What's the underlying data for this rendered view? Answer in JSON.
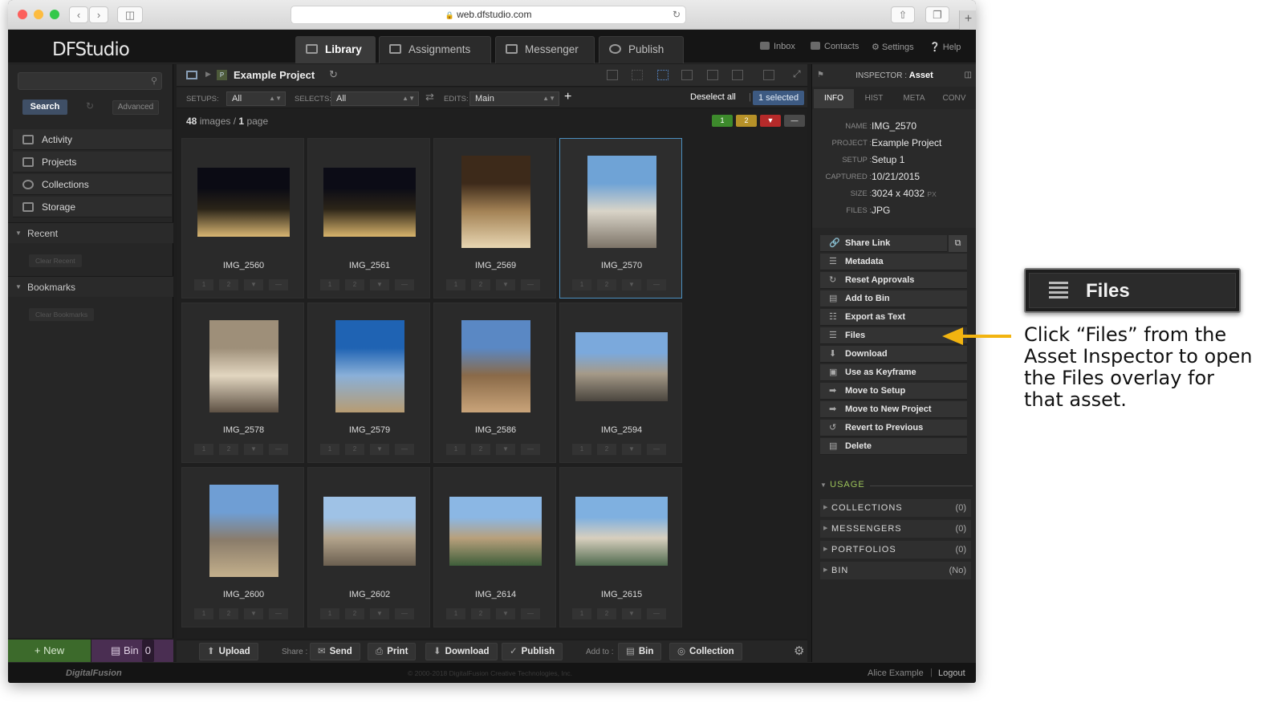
{
  "browser": {
    "url": "web.dfstudio.com"
  },
  "app": {
    "logo": "DFStudio",
    "tabs": [
      "Library",
      "Assignments",
      "Messenger",
      "Publish"
    ],
    "top_links": [
      "Inbox",
      "Contacts",
      "Settings",
      "Help"
    ]
  },
  "sidebar": {
    "search_button": "Search",
    "advanced_button": "Advanced",
    "nav": [
      "Activity",
      "Projects",
      "Collections",
      "Storage"
    ],
    "recent": "Recent",
    "clear_recent": "Clear Recent",
    "bookmarks": "Bookmarks",
    "clear_bookmarks": "Clear Bookmarks",
    "new_button": "+ New",
    "bin_label": "Bin",
    "bin_count": "0"
  },
  "library": {
    "project_badge": "P",
    "title": "Example Project",
    "setups_label": "SETUPS:",
    "setups_value": "All",
    "selects_label": "SELECTS:",
    "selects_value": "All",
    "edits_label": "EDITS:",
    "edits_value": "Main",
    "deselect": "Deselect all",
    "selected": "1 selected",
    "count_images": "48",
    "count_images_label": "images /",
    "count_pages": "1",
    "count_pages_label": "page",
    "rating_buttons": [
      "1",
      "2",
      "▼",
      "—"
    ],
    "images": [
      {
        "name": "IMG_2560"
      },
      {
        "name": "IMG_2561"
      },
      {
        "name": "IMG_2569"
      },
      {
        "name": "IMG_2570",
        "selected": true
      },
      {
        "name": "IMG_2578"
      },
      {
        "name": "IMG_2579"
      },
      {
        "name": "IMG_2586"
      },
      {
        "name": "IMG_2594"
      },
      {
        "name": "IMG_2600"
      },
      {
        "name": "IMG_2602"
      },
      {
        "name": "IMG_2614"
      },
      {
        "name": "IMG_2615"
      }
    ],
    "bottom": {
      "upload": "Upload",
      "share_label": "Share :",
      "send": "Send",
      "print": "Print",
      "download": "Download",
      "publish": "Publish",
      "addto_label": "Add to :",
      "bin": "Bin",
      "collection": "Collection"
    }
  },
  "inspector": {
    "title_prefix": "INSPECTOR :",
    "title": "Asset",
    "tabs": [
      "INFO",
      "HIST",
      "META",
      "CONV"
    ],
    "fields": [
      {
        "key": "NAME :",
        "value": "IMG_2570"
      },
      {
        "key": "PROJECT :",
        "value": "Example Project"
      },
      {
        "key": "SETUP :",
        "value": "Setup 1"
      },
      {
        "key": "CAPTURED :",
        "value": "10/21/2015"
      },
      {
        "key": "SIZE :",
        "value": "3024 x 4032",
        "unit": "PX"
      },
      {
        "key": "FILES :",
        "value": "JPG"
      }
    ],
    "actions": [
      "Share Link",
      "Metadata",
      "Reset Approvals",
      "Add to Bin",
      "Export as Text",
      "Files",
      "Download",
      "Use as Keyframe",
      "Move to Setup",
      "Move to New Project",
      "Revert to Previous",
      "Delete"
    ],
    "usage_title": "USAGE",
    "usage": [
      {
        "label": "COLLECTIONS",
        "value": "(0)"
      },
      {
        "label": "MESSENGERS",
        "value": "(0)"
      },
      {
        "label": "PORTFOLIOS",
        "value": "(0)"
      },
      {
        "label": "BIN",
        "value": "(No)"
      }
    ]
  },
  "footer": {
    "brand": "DigitalFusion",
    "copyright": "© 2000-2018 DigitalFusion Creative Technologies, Inc.",
    "user": "Alice Example",
    "logout": "Logout"
  },
  "callout": {
    "title": "Files",
    "instruction": "Click “Files” from the Asset Inspector to open the Files overlay for that asset.",
    "arrow_color": "#f2b410"
  }
}
